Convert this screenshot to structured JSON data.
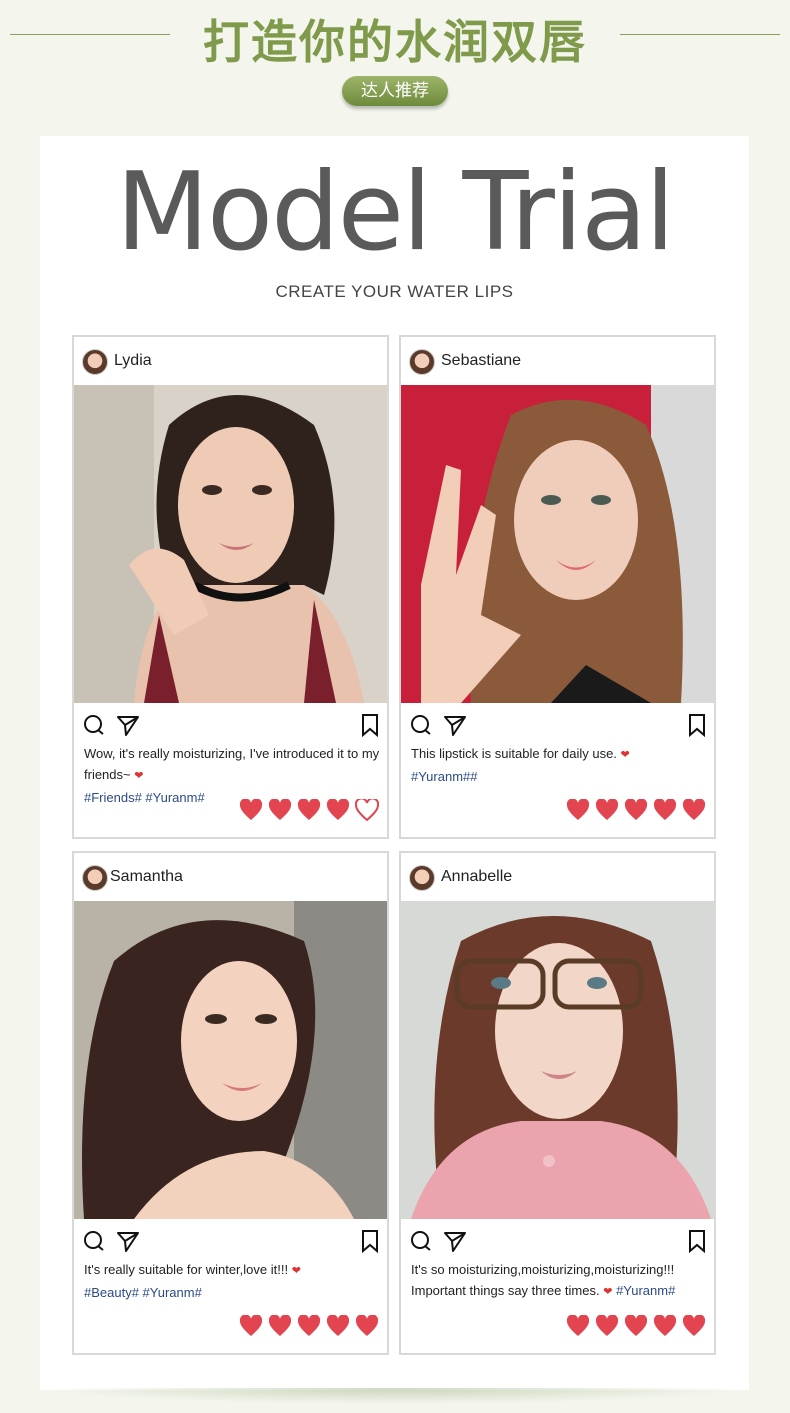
{
  "header": {
    "cn_title": "打造你的水润双唇",
    "pill_label": "达人推荐"
  },
  "panel": {
    "title": "Model Trial",
    "subtitle": "CREATE YOUR WATER LIPS"
  },
  "cards": [
    {
      "username": "Lydia",
      "caption": "Wow, it's really moisturizing, I've introduced it to my friends~",
      "tags": "#Friends# #Yuranm#",
      "hearts": 5
    },
    {
      "username": "Sebastiane",
      "caption": "This lipstick is suitable for daily use.",
      "tags": "#Yuranm##",
      "hearts": 5
    },
    {
      "username": "Samantha",
      "caption": "It's really suitable for winter,love it!!!",
      "tags": "#Beauty# #Yuranm#",
      "hearts": 5
    },
    {
      "username": "Annabelle",
      "caption": "It's so moisturizing,moisturizing,moisturizing!!! Important things say three times.",
      "tags": "#Yuranm#",
      "hearts": 5
    }
  ],
  "icons": {
    "comment": "comment-icon",
    "share": "share-icon",
    "bookmark": "bookmark-icon",
    "heart": "heart-icon"
  },
  "colors": {
    "accent_green": "#7f9a4a",
    "heart_red": "#e2454f",
    "tag_blue": "#2b4a86"
  }
}
